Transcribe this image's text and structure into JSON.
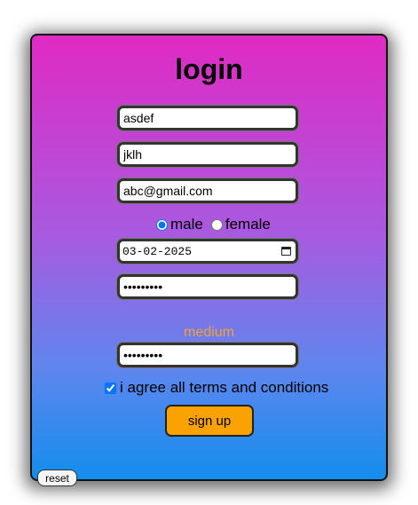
{
  "form": {
    "title": "login",
    "first_name": "asdef",
    "last_name": "jklh",
    "email": "abc@gmail.com",
    "gender_options": [
      {
        "label": "male",
        "checked": true
      },
      {
        "label": "female",
        "checked": false
      }
    ],
    "date": "03-02-2025",
    "password": "•••••••••",
    "password_strength": "medium",
    "confirm_password": "•••••••••",
    "agree_label": "i agree all terms and conditions",
    "agree_checked": true,
    "signup_label": "sign up",
    "reset_label": "reset"
  },
  "colors": {
    "gradient_top": "#e02ac4",
    "gradient_bottom": "#138ded",
    "strength_text": "#f4a23a",
    "signup_button": "#f9a200"
  }
}
